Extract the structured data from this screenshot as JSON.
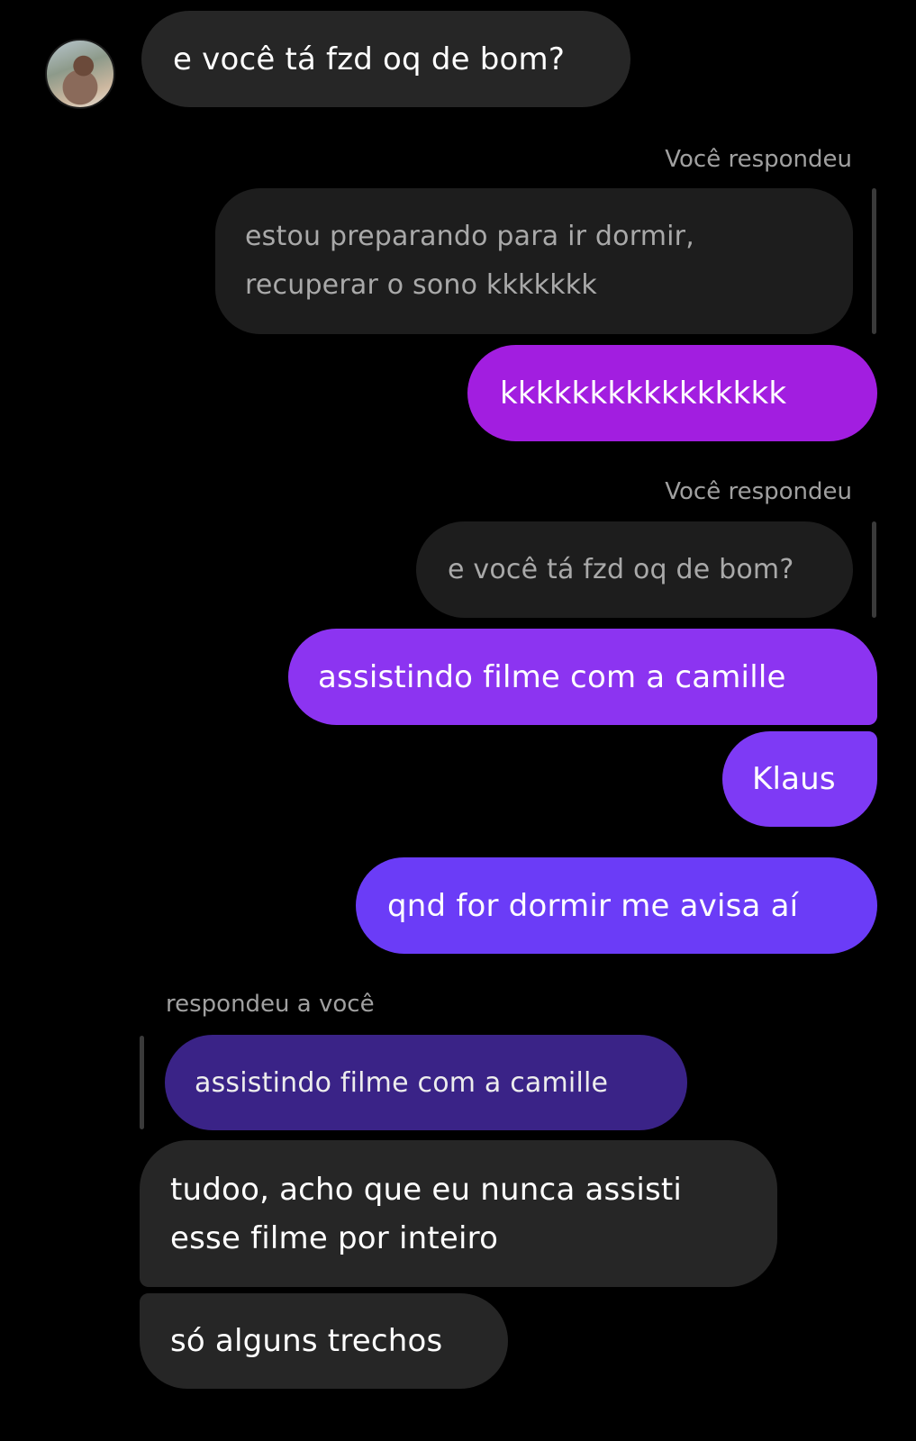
{
  "messages": {
    "m1": "e você tá fzd oq de bom?",
    "reply_label_1": "Você respondeu",
    "quote_1_line1": "estou preparando para ir dormir,",
    "quote_1_line2": "recuperar o sono kkkkkkk",
    "m2": "kkkkkkkkkkkkkkkk",
    "reply_label_2": "Você respondeu",
    "quote_2": "e você tá fzd oq de bom?",
    "m3": "assistindo filme com a camille",
    "m4": "Klaus",
    "m5": "qnd for dormir me avisa aí",
    "reply_label_3": "respondeu a você",
    "quote_3": "assistindo filme com a camille",
    "m6_line1": "tudoo, acho que eu nunca assisti",
    "m6_line2": "esse filme por inteiro",
    "m7": "só alguns trechos"
  },
  "colors": {
    "background": "#000000",
    "incoming_bubble": "#262626",
    "quoted_bubble": "#1d1d1d",
    "outgoing_gradient_top": "#a21ee0",
    "outgoing_gradient_bottom": "#6b3cf7",
    "quoted_purple": "#3a2387"
  }
}
